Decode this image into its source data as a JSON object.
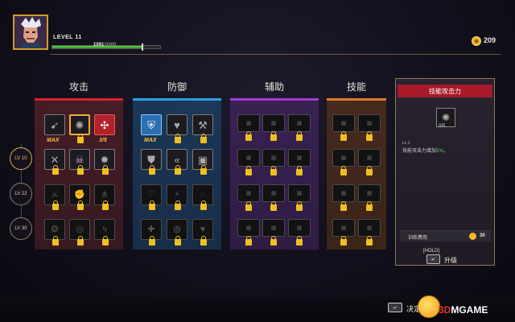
{
  "player": {
    "level_label": "LEVEL 11",
    "xp_current": "1091",
    "xp_max": "/3000",
    "xp_progress": 0.83
  },
  "currency": {
    "coins": "209"
  },
  "tiers": [
    "LV 10",
    "LV 22",
    "LV 30"
  ],
  "columns": [
    {
      "title": "攻击",
      "color": "#d9222f"
    },
    {
      "title": "防御",
      "color": "#2d9ee0"
    },
    {
      "title": "辅助",
      "color": "#a33ad6"
    },
    {
      "title": "技能",
      "color": "#e07a2a"
    }
  ],
  "badges": {
    "attack_1": "MAX",
    "attack_3": "3/5",
    "defense_1": "MAX"
  },
  "detail": {
    "title": "技能攻击力",
    "rank": "0/5",
    "level": "Lv 1",
    "desc_prefix": "技能攻击力增加",
    "desc_pct": "5%",
    "desc_suffix": "。",
    "cost_label": "训练费用",
    "cost_value": "30",
    "hold_label": "[HOLD]",
    "upgrade_label": "升级"
  },
  "footer": {
    "confirm_label": "决定"
  },
  "watermark": {
    "part1": "3D",
    "part2": "MGAME"
  }
}
